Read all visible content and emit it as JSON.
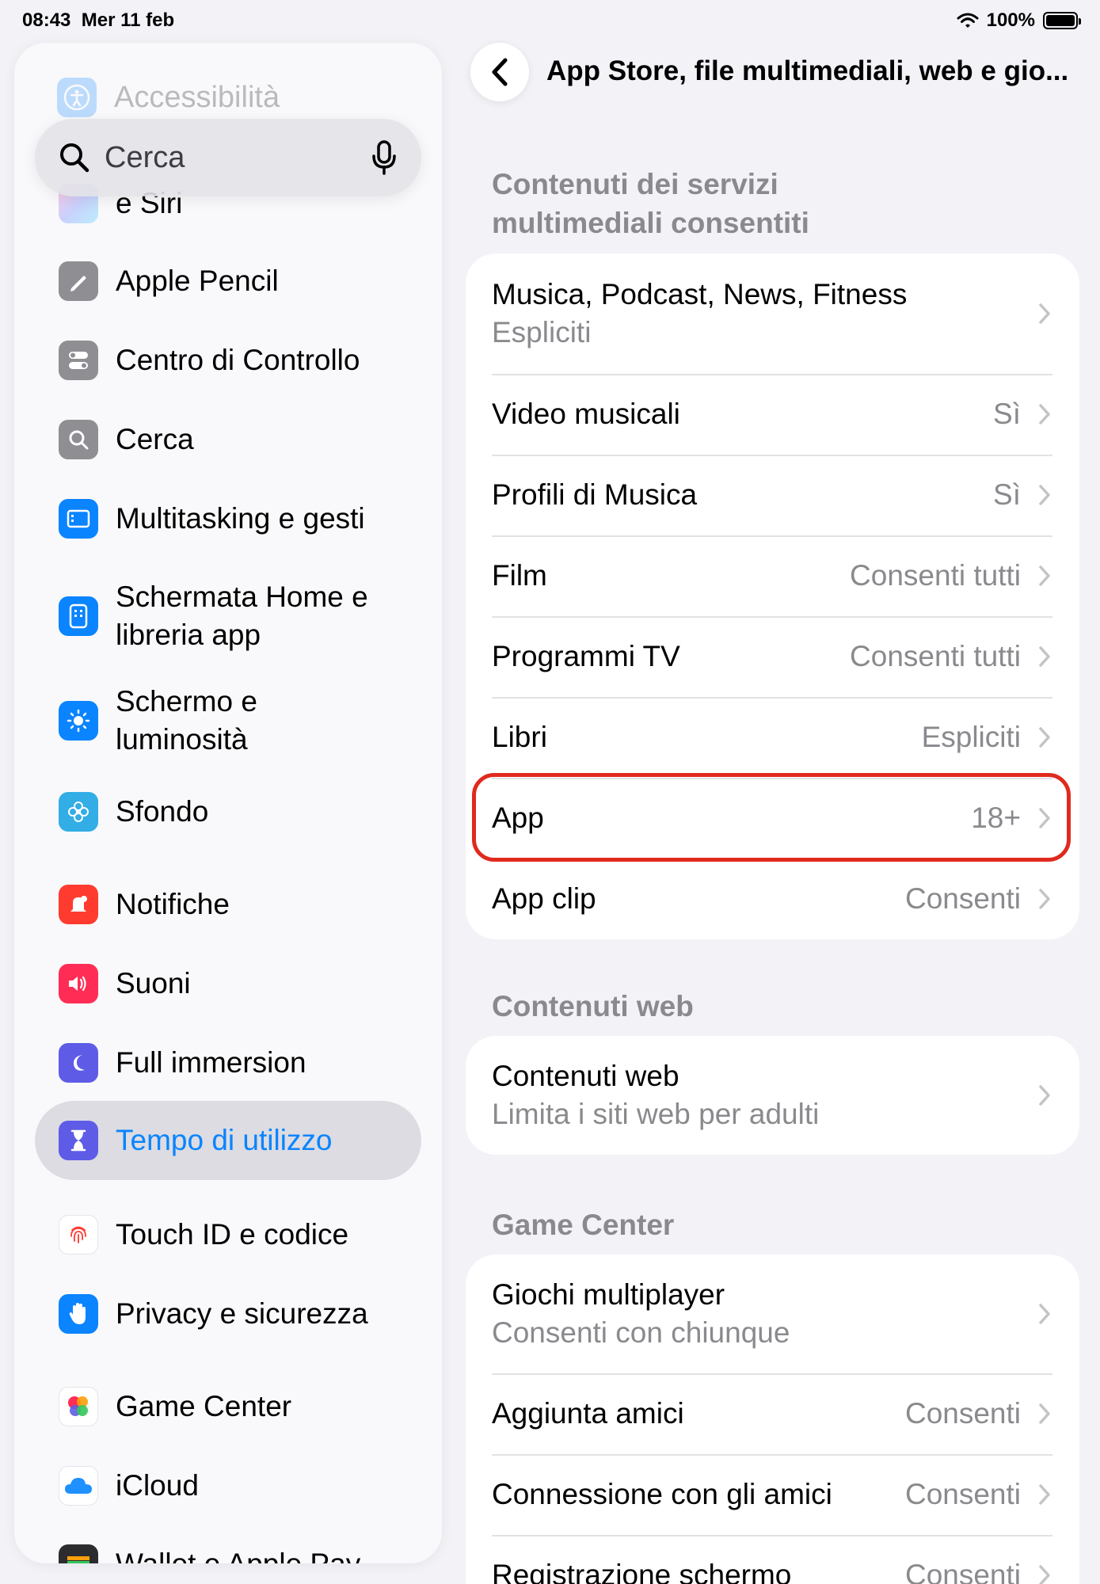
{
  "status_bar": {
    "time": "08:43",
    "date": "Mer 11 feb",
    "battery": "100%"
  },
  "sidebar": {
    "faded_item": "Accessibilità",
    "search_placeholder": "Cerca",
    "items": [
      {
        "label": "e Siri",
        "icon": "siri-icon"
      },
      {
        "label": "Apple Pencil",
        "icon": "pencil-icon",
        "color": "#8e8e93"
      },
      {
        "label": "Centro di Controllo",
        "icon": "toggles-icon",
        "color": "#8e8e93"
      },
      {
        "label": "Cerca",
        "icon": "search-icon",
        "color": "#8e8e93"
      },
      {
        "label": "Multitasking e gesti",
        "icon": "multitasking-icon",
        "color": "#0a84ff"
      },
      {
        "label": "Schermata Home e libreria app",
        "icon": "home-screen-icon",
        "color": "#0a84ff"
      },
      {
        "label": "Schermo e luminosità",
        "icon": "sun-icon",
        "color": "#0a84ff"
      },
      {
        "label": "Sfondo",
        "icon": "flower-icon",
        "color": "#32ade6"
      },
      {
        "label": "Notifiche",
        "icon": "bell-icon",
        "color": "#ff3b30"
      },
      {
        "label": "Suoni",
        "icon": "speaker-icon",
        "color": "#ff2d55"
      },
      {
        "label": "Full immersion",
        "icon": "moon-icon",
        "color": "#5e5ce6"
      },
      {
        "label": "Tempo di utilizzo",
        "icon": "hourglass-icon",
        "color": "#5e5ce6"
      },
      {
        "label": "Touch ID e codice",
        "icon": "fingerprint-icon",
        "color": "#ff3b30"
      },
      {
        "label": "Privacy e sicurezza",
        "icon": "hand-icon",
        "color": "#0a84ff"
      },
      {
        "label": "Game Center",
        "icon": "game-center-icon"
      },
      {
        "label": "iCloud",
        "icon": "cloud-icon",
        "color": "#0a84ff"
      },
      {
        "label": "Wallet e Apple Pay",
        "icon": "wallet-icon"
      }
    ]
  },
  "nav": {
    "title": "App Store, file multimediali, web e gio..."
  },
  "sections": [
    {
      "header": "Contenuti dei servizi multimediali consentiti",
      "rows": [
        {
          "title": "Musica, Podcast, News, Fitness",
          "subtitle": "Espliciti"
        },
        {
          "title": "Video musicali",
          "value": "Sì"
        },
        {
          "title": "Profili di Musica",
          "value": "Sì"
        },
        {
          "title": "Film",
          "value": "Consenti tutti"
        },
        {
          "title": "Programmi TV",
          "value": "Consenti tutti"
        },
        {
          "title": "Libri",
          "value": "Espliciti"
        },
        {
          "title": "App",
          "value": "18+"
        },
        {
          "title": "App clip",
          "value": "Consenti"
        }
      ]
    },
    {
      "header": "Contenuti web",
      "rows": [
        {
          "title": "Contenuti web",
          "subtitle": "Limita i siti web per adulti"
        }
      ]
    },
    {
      "header": "Game Center",
      "rows": [
        {
          "title": "Giochi multiplayer",
          "subtitle": "Consenti con chiunque"
        },
        {
          "title": "Aggiunta amici",
          "value": "Consenti"
        },
        {
          "title": "Connessione con gli amici",
          "value": "Consenti"
        },
        {
          "title": "Registrazione schermo",
          "value": "Consenti"
        }
      ]
    }
  ],
  "colors": {
    "accent": "#0a84ff",
    "highlight_border": "#e02a1e",
    "secondary_text": "#8a8a8e"
  }
}
